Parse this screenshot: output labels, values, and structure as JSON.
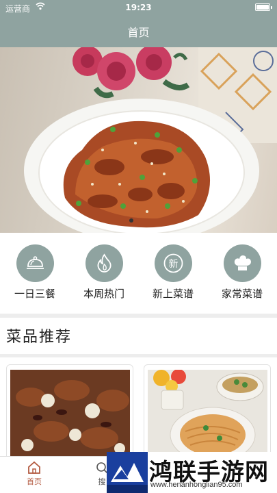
{
  "status_bar": {
    "carrier": "运营商",
    "time": "19:23"
  },
  "header": {
    "title": "首页"
  },
  "categories": [
    {
      "label": "一日三餐",
      "icon": "dining-cloche-icon"
    },
    {
      "label": "本周热门",
      "icon": "flame-icon"
    },
    {
      "label": "新上菜谱",
      "icon": "new-badge-icon",
      "badge_text": "新"
    },
    {
      "label": "家常菜谱",
      "icon": "chef-hat-icon"
    }
  ],
  "section": {
    "title": "菜品推荐"
  },
  "tabbar": {
    "items": [
      {
        "label": "首页",
        "icon": "home-icon",
        "active": true
      },
      {
        "label": "搜",
        "icon": "search-icon",
        "active": false
      }
    ],
    "active_color": "#b35a40"
  },
  "watermark": {
    "title": "鸿联手游网",
    "url": "www.henanhonglian95.com"
  },
  "colors": {
    "accent": "#8fa3a0",
    "divider": "#ededed"
  }
}
